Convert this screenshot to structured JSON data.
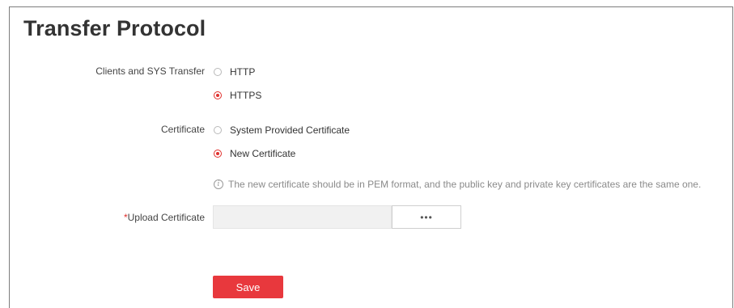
{
  "page": {
    "title": "Transfer Protocol"
  },
  "transfer": {
    "label": "Clients and SYS Transfer",
    "options": [
      {
        "label": "HTTP",
        "checked": false
      },
      {
        "label": "HTTPS",
        "checked": true
      }
    ]
  },
  "certificate": {
    "label": "Certificate",
    "options": [
      {
        "label": "System Provided Certificate",
        "checked": false
      },
      {
        "label": "New Certificate",
        "checked": true
      }
    ],
    "hint_icon": "info-icon",
    "hint": "The new certificate should be in PEM format, and the public key and private key certificates are the same one."
  },
  "upload": {
    "required_mark": "*",
    "label": "Upload Certificate",
    "value": "",
    "browse_label": "•••"
  },
  "actions": {
    "save_label": "Save"
  },
  "colors": {
    "accent": "#e8383d",
    "required": "#e0302d"
  }
}
